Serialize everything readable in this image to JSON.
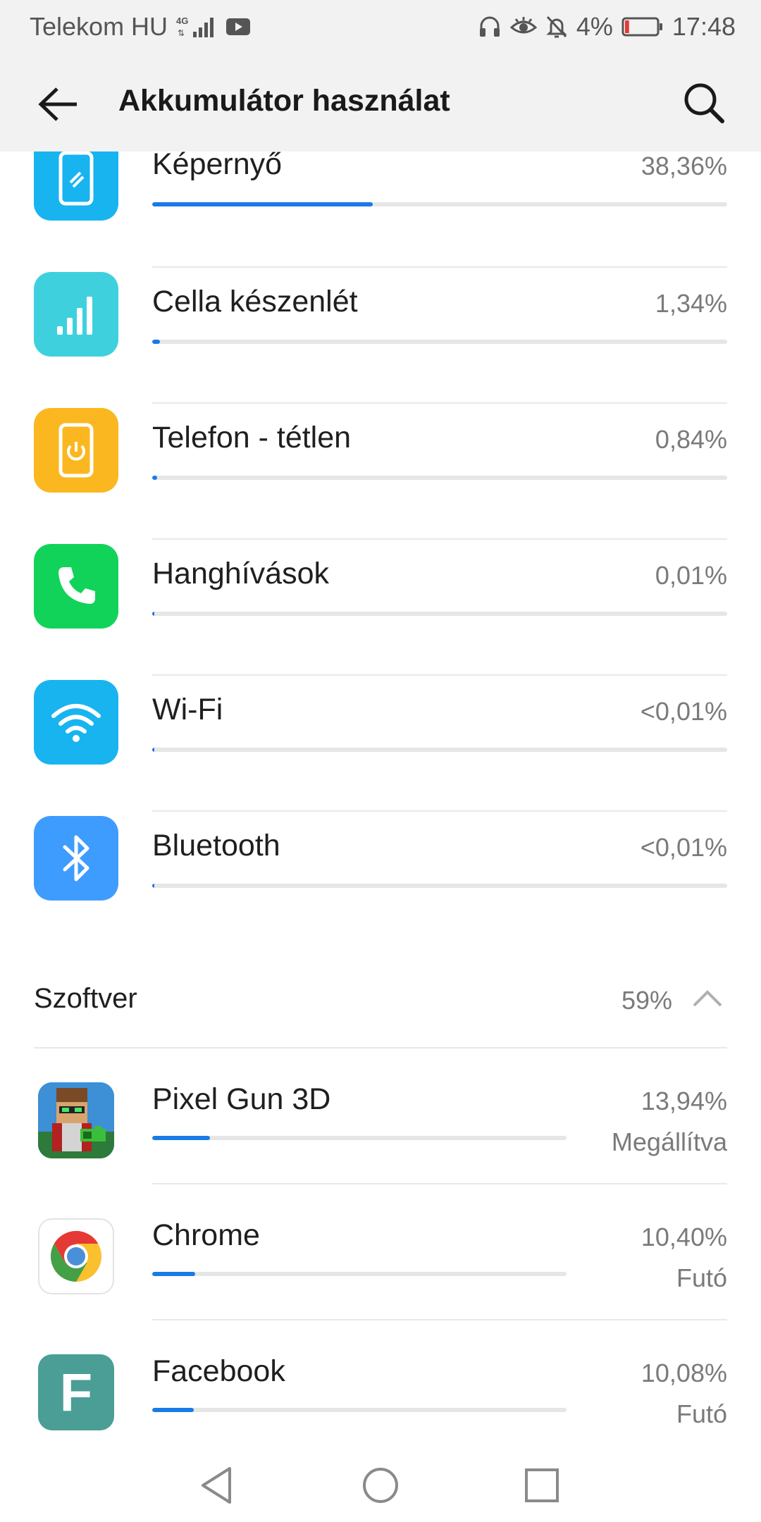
{
  "status_bar": {
    "carrier": "Telekom HU",
    "network": "4G",
    "battery_percent": "4%",
    "time": "17:48",
    "battery_level": 0.04,
    "battery_color": "#e53935"
  },
  "app_bar": {
    "title": "Akkumulátor használat",
    "back_icon": "arrow-left-icon",
    "search_icon": "search-icon"
  },
  "hardware": [
    {
      "label": "Képernyő",
      "percent": "38,36%",
      "usage": 0.3836,
      "icon": "phone-screen-icon",
      "color": "#18b4f0"
    },
    {
      "label": "Cella készenlét",
      "percent": "1,34%",
      "usage": 0.0134,
      "icon": "cell-signal-icon",
      "color": "#3fd0de"
    },
    {
      "label": "Telefon - tétlen",
      "percent": "0,84%",
      "usage": 0.0084,
      "icon": "phone-idle-icon",
      "color": "#fbb71f"
    },
    {
      "label": "Hanghívások",
      "percent": "0,01%",
      "usage": 0.0001,
      "icon": "phone-call-icon",
      "color": "#12d35a"
    },
    {
      "label": "Wi-Fi",
      "percent": "<0,01%",
      "usage": 5e-05,
      "icon": "wifi-icon",
      "color": "#18b4f0"
    },
    {
      "label": "Bluetooth",
      "percent": "<0,01%",
      "usage": 5e-05,
      "icon": "bluetooth-icon",
      "color": "#3f9cff"
    }
  ],
  "software_section": {
    "title": "Szoftver",
    "percent": "59%",
    "collapse_icon": "chevron-up-icon"
  },
  "apps": [
    {
      "label": "Pixel Gun 3D",
      "percent": "13,94%",
      "status": "Megállítva",
      "usage": 0.1394,
      "icon": "pixel-gun-3d-icon"
    },
    {
      "label": "Chrome",
      "percent": "10,40%",
      "status": "Futó",
      "usage": 0.104,
      "icon": "chrome-icon"
    },
    {
      "label": "Facebook",
      "percent": "10,08%",
      "status": "Futó",
      "usage": 0.1008,
      "icon": "facebook-lite-icon",
      "letter": "F",
      "color": "#4a9e95"
    }
  ],
  "nav_bar": {
    "back_icon": "nav-back-icon",
    "home_icon": "nav-home-icon",
    "recents_icon": "nav-recents-icon"
  }
}
